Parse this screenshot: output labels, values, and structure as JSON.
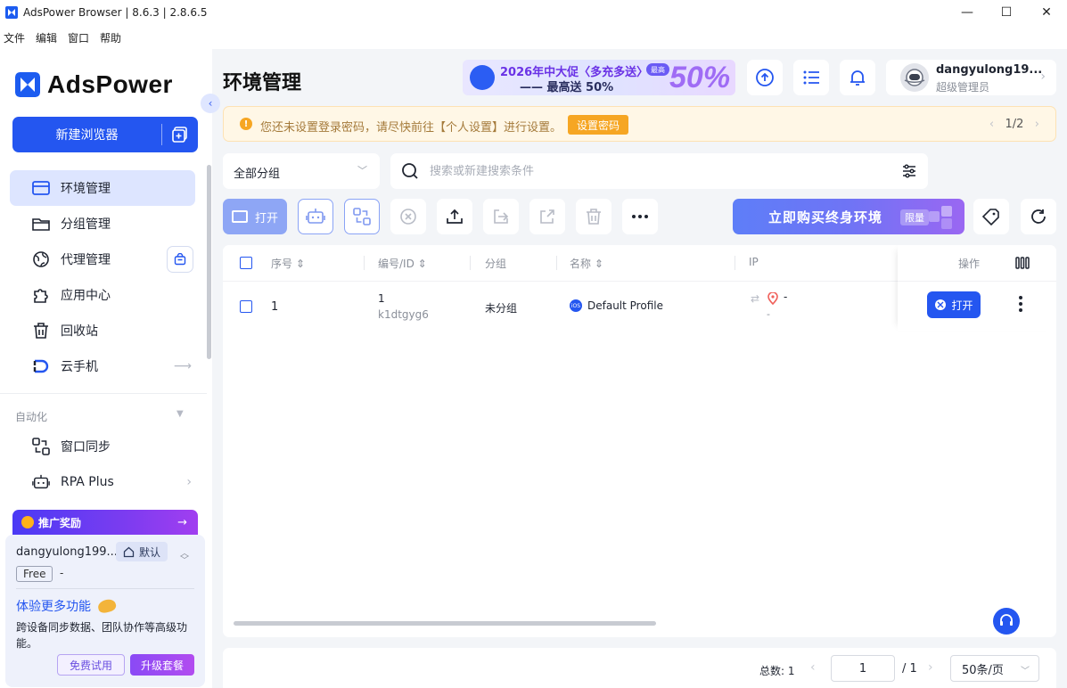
{
  "window": {
    "title": "AdsPower Browser | 8.6.3 | 2.8.6.5",
    "minimize": "—",
    "maximize": "☐",
    "close": "✕"
  },
  "menu": [
    "文件",
    "编辑",
    "窗口",
    "帮助"
  ],
  "sidebar": {
    "brand": "AdsPower",
    "new_browser": "新建浏览器",
    "items": [
      {
        "label": "环境管理",
        "icon": "browser-window-icon",
        "active": true
      },
      {
        "label": "分组管理",
        "icon": "folder-icon"
      },
      {
        "label": "代理管理",
        "icon": "globe-icon"
      },
      {
        "label": "应用中心",
        "icon": "puzzle-icon"
      },
      {
        "label": "回收站",
        "icon": "trash-icon"
      },
      {
        "label": "云手机",
        "icon": "cloud-phone-icon"
      }
    ],
    "automation_label": "自动化",
    "automation_items": [
      {
        "label": "窗口同步",
        "icon": "sync-icon"
      },
      {
        "label": "RPA Plus",
        "icon": "robot-icon"
      }
    ],
    "promo": "推广奖励",
    "user": {
      "name": "dangyulong199...",
      "default_label": "默认",
      "plan": "Free",
      "plan_extra": "-",
      "explore": "体验更多功能",
      "desc": "跨设备同步数据、团队协作等高级功能。",
      "trial": "免费试用",
      "upgrade": "升级套餐"
    }
  },
  "header": {
    "title": "环境管理",
    "banner": {
      "line1": "2026年中大促〈多充多送〉",
      "line2": "—— 最高送 50%",
      "tag": "最高",
      "pct": "50%"
    },
    "user": {
      "name": "dangyulong19...",
      "role": "超级管理员"
    }
  },
  "notice": {
    "text": "您还未设置登录密码，请尽快前往【个人设置】进行设置。",
    "button": "设置密码",
    "page": "1",
    "total": "/2"
  },
  "filters": {
    "group": "全部分组",
    "search_placeholder": "搜索或新建搜索条件"
  },
  "toolbar": {
    "open": "打开",
    "buy": "立即购买终身环境",
    "buy_tag": "限量"
  },
  "table": {
    "columns": [
      "序号",
      "编号/ID",
      "分组",
      "名称",
      "IP",
      "操作"
    ],
    "rows": [
      {
        "seq": "1",
        "no": "1",
        "id": "k1dtgyg6",
        "group": "未分组",
        "os": "iOS",
        "name": "Default Profile",
        "ip": "-",
        "ip2": "-",
        "action": "打开"
      }
    ]
  },
  "pagination": {
    "total": "总数: 1",
    "page": "1",
    "of": "/ 1",
    "per_page": "50条/页"
  },
  "colors": {
    "primary": "#2456f0",
    "active_bg": "#dde5ff",
    "warning": "#f6a623"
  }
}
